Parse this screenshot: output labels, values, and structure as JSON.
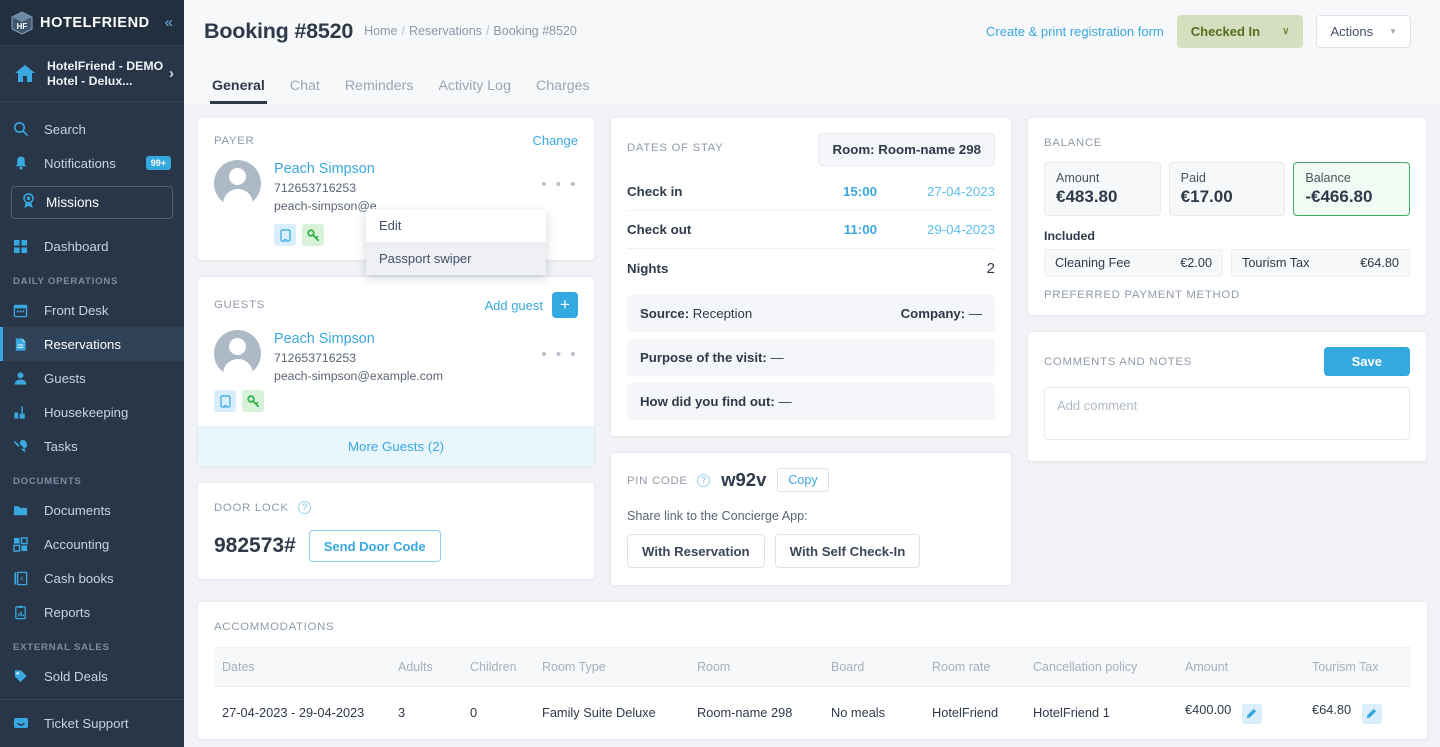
{
  "sidebar": {
    "logo_text": "HOTELFRIEND",
    "logo_mark": "hotelfriend-cube-icon",
    "collapse_label": "«",
    "hotel_name": "HotelFriend - DEMO Hotel - Delux...",
    "hotel_arrow": "›",
    "search": {
      "label": "Search",
      "icon": "search-icon"
    },
    "notifications": {
      "label": "Notifications",
      "icon": "bell-icon",
      "badge": "99+"
    },
    "missions": {
      "label": "Missions",
      "icon": "award-ribbon-icon"
    },
    "dashboard": {
      "label": "Dashboard",
      "icon": "grid-icon"
    },
    "sections": [
      {
        "title": "DAILY OPERATIONS",
        "items": [
          {
            "label": "Front Desk",
            "icon": "calendar-icon",
            "active": false
          },
          {
            "label": "Reservations",
            "icon": "document-icon",
            "active": true
          },
          {
            "label": "Guests",
            "icon": "user-icon",
            "active": false
          },
          {
            "label": "Housekeeping",
            "icon": "housekeeping-icon",
            "active": false
          },
          {
            "label": "Tasks",
            "icon": "wrench-screwdriver-icon",
            "active": false
          }
        ]
      },
      {
        "title": "DOCUMENTS",
        "items": [
          {
            "label": "Documents",
            "icon": "folder-icon",
            "active": false
          },
          {
            "label": "Accounting",
            "icon": "calculator-icon",
            "active": false
          },
          {
            "label": "Cash books",
            "icon": "cashbook-icon",
            "active": false
          },
          {
            "label": "Reports",
            "icon": "clipboard-chart-icon",
            "active": false
          }
        ]
      },
      {
        "title": "EXTERNAL SALES",
        "items": [
          {
            "label": "Sold Deals",
            "icon": "tag-icon",
            "active": false
          }
        ]
      }
    ],
    "support": {
      "label": "Ticket Support",
      "icon": "chat-bubble-icon"
    }
  },
  "header": {
    "title": "Booking #8520",
    "breadcrumbs": [
      "Home",
      "Reservations",
      "Booking #8520"
    ],
    "breadcrumb_separator": "/",
    "registration_link": "Create & print registration form",
    "status_label": "Checked In",
    "status_caret": "∨",
    "actions_label": "Actions",
    "actions_caret": "▼",
    "status_bg": "#d5dfc0",
    "status_fg": "#53701e"
  },
  "tabs": [
    {
      "label": "General",
      "active": true
    },
    {
      "label": "Chat",
      "active": false
    },
    {
      "label": "Reminders",
      "active": false
    },
    {
      "label": "Activity Log",
      "active": false
    },
    {
      "label": "Charges",
      "active": false
    }
  ],
  "payer": {
    "header": "PAYER",
    "change_label": "Change",
    "name": "Peach Simpson",
    "phone": "712653716253",
    "email": "peach-simpson@e",
    "dots": "• • •",
    "chips": [
      {
        "icon": "mobile-phone-icon",
        "color": "#d8eefb"
      },
      {
        "icon": "key-icon",
        "color": "#d7f2d9"
      }
    ],
    "menu": [
      {
        "label": "Edit",
        "hover": false
      },
      {
        "label": "Passport swiper",
        "hover": true
      }
    ]
  },
  "guests": {
    "header": "GUESTS",
    "add_label": "Add guest",
    "add_icon": "plus-icon",
    "name": "Peach Simpson",
    "phone": "712653716253",
    "email": "peach-simpson@example.com",
    "dots": "• • •",
    "more_label": "More Guests (2)"
  },
  "door_lock": {
    "header": "DOOR LOCK",
    "help_icon": "question-mark-icon",
    "code": "982573#",
    "send_label": "Send Door Code"
  },
  "dates_of_stay": {
    "header": "DATES OF STAY",
    "room_button": "Room: Room-name 298",
    "rows": [
      {
        "label": "Check in",
        "time": "15:00",
        "date": "27-04-2023"
      },
      {
        "label": "Check out",
        "time": "11:00",
        "date": "29-04-2023"
      }
    ],
    "nights_label": "Nights",
    "nights_value": "2",
    "source_label": "Source:",
    "source_value": "Reception",
    "company_label": "Company:",
    "company_value": "—",
    "purpose_label": "Purpose of the visit:",
    "purpose_value": "—",
    "findout_label": "How did you find out:",
    "findout_value": "—"
  },
  "pin_code": {
    "header": "PIN CODE",
    "help_icon": "question-mark-icon",
    "value": "w92v",
    "copy_label": "Copy",
    "share_label": "Share link to the Concierge App:",
    "with_reservation": "With Reservation",
    "with_self_checkin": "With Self Check-In"
  },
  "balance": {
    "header": "BALANCE",
    "boxes": [
      {
        "label": "Amount",
        "value": "€483.80",
        "highlight": false
      },
      {
        "label": "Paid",
        "value": "€17.00",
        "highlight": false
      },
      {
        "label": "Balance",
        "value": "-€466.80",
        "highlight": true
      }
    ],
    "included_label": "Included",
    "included": [
      {
        "label": "Cleaning Fee",
        "value": "€2.00"
      },
      {
        "label": "Tourism Tax",
        "value": "€64.80"
      }
    ],
    "preferred_payment_label": "PREFERRED PAYMENT METHOD",
    "highlight_color": "#3fae5f"
  },
  "comments": {
    "header": "COMMENTS AND NOTES",
    "save_label": "Save",
    "placeholder": "Add comment",
    "value": ""
  },
  "accommodations": {
    "header": "ACCOMMODATIONS",
    "columns": [
      "Dates",
      "Adults",
      "Children",
      "Room Type",
      "Room",
      "Board",
      "Room rate",
      "Cancellation policy",
      "Amount",
      "Tourism Tax"
    ],
    "rows": [
      {
        "dates": "27-04-2023 - 29-04-2023",
        "adults": "3",
        "children": "0",
        "room_type": "Family Suite Deluxe",
        "room": "Room-name 298",
        "board": "No meals",
        "room_rate": "HotelFriend",
        "cancellation_policy": "HotelFriend 1",
        "amount": "€400.00",
        "amount_edit_icon": "pencil-icon",
        "tourism_tax": "€64.80",
        "tourism_tax_edit_icon": "pencil-icon"
      }
    ]
  },
  "theme": {
    "accent_blue": "#34a8e0",
    "sidebar_bg": "#283647",
    "page_bg": "#f1f3f6",
    "text_dark": "#2e3a4a"
  }
}
